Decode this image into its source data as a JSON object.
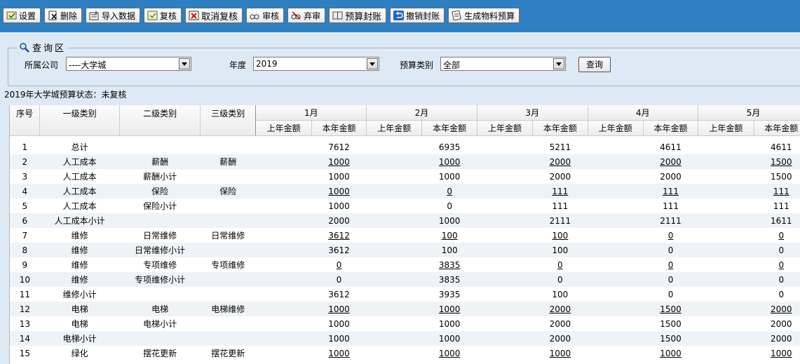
{
  "toolbar": {
    "buttons": [
      {
        "label": "设置",
        "icon": "settings-icon"
      },
      {
        "label": "删除",
        "icon": "delete-icon"
      },
      {
        "label": "导入数据",
        "icon": "import-icon"
      },
      {
        "label": "复核",
        "icon": "review-icon"
      },
      {
        "label": "取消复核",
        "icon": "cancel-review-icon"
      },
      {
        "label": "审核",
        "icon": "audit-icon"
      },
      {
        "label": "弃审",
        "icon": "unaudit-icon"
      },
      {
        "label": "预算封账",
        "icon": "lock-ledger-icon"
      },
      {
        "label": "撤销封账",
        "icon": "undo-icon"
      },
      {
        "label": "生成物料预算",
        "icon": "generate-icon"
      }
    ]
  },
  "query": {
    "legend": "查询区",
    "company_label": "所属公司",
    "company_value": "----大学城",
    "year_label": "年度",
    "year_value": "2019",
    "type_label": "预算类别",
    "type_value": "全部",
    "search_label": "查询"
  },
  "status": "2019年大学城预算状态：未复核",
  "table": {
    "fixed_headers": [
      "序号",
      "一级类别",
      "二级类别",
      "三级类别"
    ],
    "months": [
      "1月",
      "2月",
      "3月",
      "4月",
      "5月"
    ],
    "sub_headers": [
      "上年金额",
      "本年金额"
    ],
    "rows": [
      {
        "no": "1",
        "l1": "总计",
        "l2": "",
        "l3": "",
        "vals": [
          "",
          "7612",
          "",
          "6935",
          "",
          "5211",
          "",
          "4611",
          "",
          "4611"
        ],
        "link": false
      },
      {
        "no": "2",
        "l1": "人工成本",
        "l2": "薪酬",
        "l3": "薪酬",
        "vals": [
          "",
          "1000",
          "",
          "1000",
          "",
          "2000",
          "",
          "2000",
          "",
          "1500"
        ],
        "link": true
      },
      {
        "no": "3",
        "l1": "人工成本",
        "l2": "薪酬小计",
        "l3": "",
        "vals": [
          "",
          "1000",
          "",
          "1000",
          "",
          "2000",
          "",
          "2000",
          "",
          "1500"
        ],
        "link": false
      },
      {
        "no": "4",
        "l1": "人工成本",
        "l2": "保险",
        "l3": "保险",
        "vals": [
          "",
          "1000",
          "",
          "0",
          "",
          "111",
          "",
          "111",
          "",
          "111"
        ],
        "link": true
      },
      {
        "no": "5",
        "l1": "人工成本",
        "l2": "保险小计",
        "l3": "",
        "vals": [
          "",
          "1000",
          "",
          "0",
          "",
          "111",
          "",
          "111",
          "",
          "111"
        ],
        "link": false
      },
      {
        "no": "6",
        "l1": "人工成本小计",
        "l2": "",
        "l3": "",
        "vals": [
          "",
          "2000",
          "",
          "1000",
          "",
          "2111",
          "",
          "2111",
          "",
          "1611"
        ],
        "link": false
      },
      {
        "no": "7",
        "l1": "维修",
        "l2": "日常维修",
        "l3": "日常维修",
        "vals": [
          "",
          "3612",
          "",
          "100",
          "",
          "100",
          "",
          "0",
          "",
          "0"
        ],
        "link": true
      },
      {
        "no": "8",
        "l1": "维修",
        "l2": "日常维修小计",
        "l3": "",
        "vals": [
          "",
          "3612",
          "",
          "100",
          "",
          "100",
          "",
          "0",
          "",
          "0"
        ],
        "link": false
      },
      {
        "no": "9",
        "l1": "维修",
        "l2": "专项维修",
        "l3": "专项维修",
        "vals": [
          "",
          "0",
          "",
          "3835",
          "",
          "0",
          "",
          "0",
          "",
          "0"
        ],
        "link": true
      },
      {
        "no": "10",
        "l1": "维修",
        "l2": "专项维修小计",
        "l3": "",
        "vals": [
          "",
          "0",
          "",
          "3835",
          "",
          "0",
          "",
          "0",
          "",
          "0"
        ],
        "link": false
      },
      {
        "no": "11",
        "l1": "维修小计",
        "l2": "",
        "l3": "",
        "vals": [
          "",
          "3612",
          "",
          "3935",
          "",
          "100",
          "",
          "0",
          "",
          "0"
        ],
        "link": false
      },
      {
        "no": "12",
        "l1": "电梯",
        "l2": "电梯",
        "l3": "电梯维修",
        "vals": [
          "",
          "1000",
          "",
          "1000",
          "",
          "2000",
          "",
          "1500",
          "",
          "2000"
        ],
        "link": true
      },
      {
        "no": "13",
        "l1": "电梯",
        "l2": "电梯小计",
        "l3": "",
        "vals": [
          "",
          "1000",
          "",
          "1000",
          "",
          "2000",
          "",
          "1500",
          "",
          "2000"
        ],
        "link": false
      },
      {
        "no": "14",
        "l1": "电梯小计",
        "l2": "",
        "l3": "",
        "vals": [
          "",
          "1000",
          "",
          "1000",
          "",
          "2000",
          "",
          "1500",
          "",
          "2000"
        ],
        "link": false
      },
      {
        "no": "15",
        "l1": "绿化",
        "l2": "摆花更新",
        "l3": "摆花更新",
        "vals": [
          "",
          "1000",
          "",
          "1000",
          "",
          "1000",
          "",
          "1000",
          "",
          "1000"
        ],
        "link": true
      }
    ]
  }
}
